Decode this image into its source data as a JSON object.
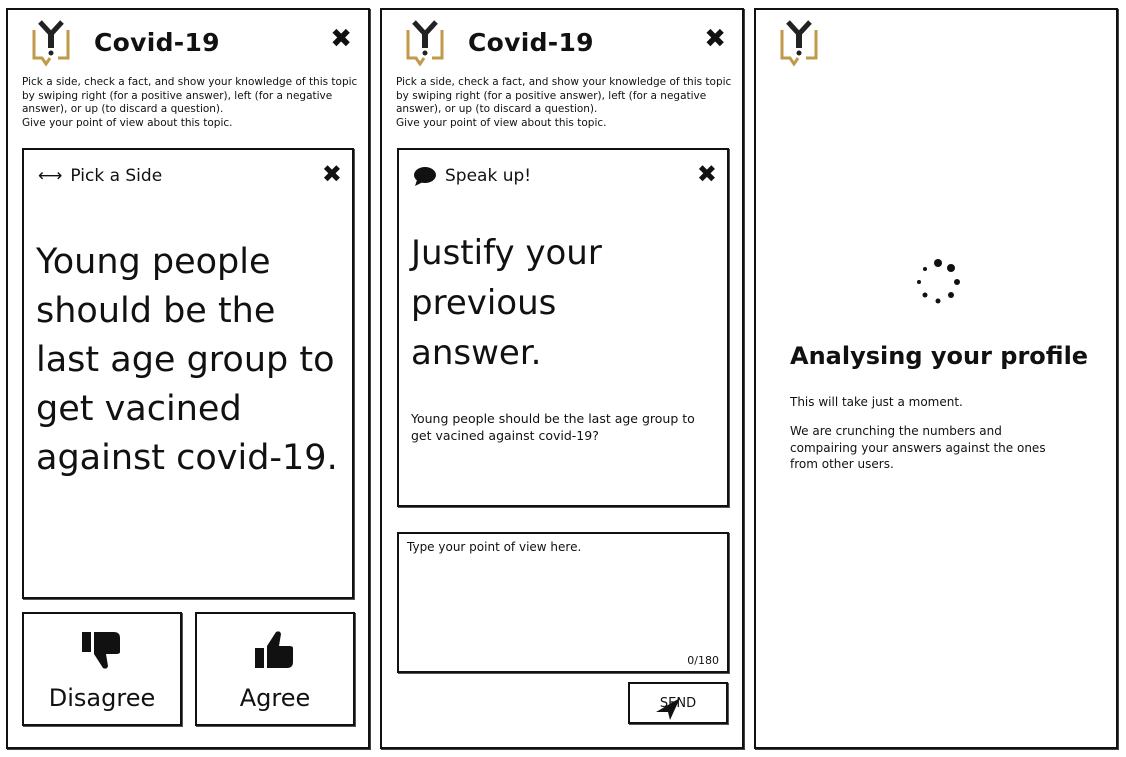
{
  "app_title": "Covid-19",
  "instructions": [
    "Pick a side, check a fact, and show your knowledge of this topic",
    "by swiping right (for a positive answer), left (for a negative",
    "answer), or up (to discard a question).",
    "Give your point of view about this topic."
  ],
  "screen1": {
    "card_header": "Pick a Side",
    "statement": "Young people should be the last age group to get vacined against covid-19.",
    "disagree_label": "Disagree",
    "agree_label": "Agree"
  },
  "screen2": {
    "card_header": "Speak up!",
    "prompt": "Justify your previous answer.",
    "question": "Young people should be the last age group to get vacined against covid-19?",
    "input_placeholder": "Type your point of view here.",
    "char_count": "0/180",
    "send_label": "SEND"
  },
  "screen3": {
    "heading": "Analysing your profile",
    "line1": "This will take just a moment.",
    "line2": "We are crunching the numbers and compairing your answers against the ones from other users."
  },
  "colors": {
    "logo_gold": "#c09a4a",
    "ink": "#111111"
  }
}
